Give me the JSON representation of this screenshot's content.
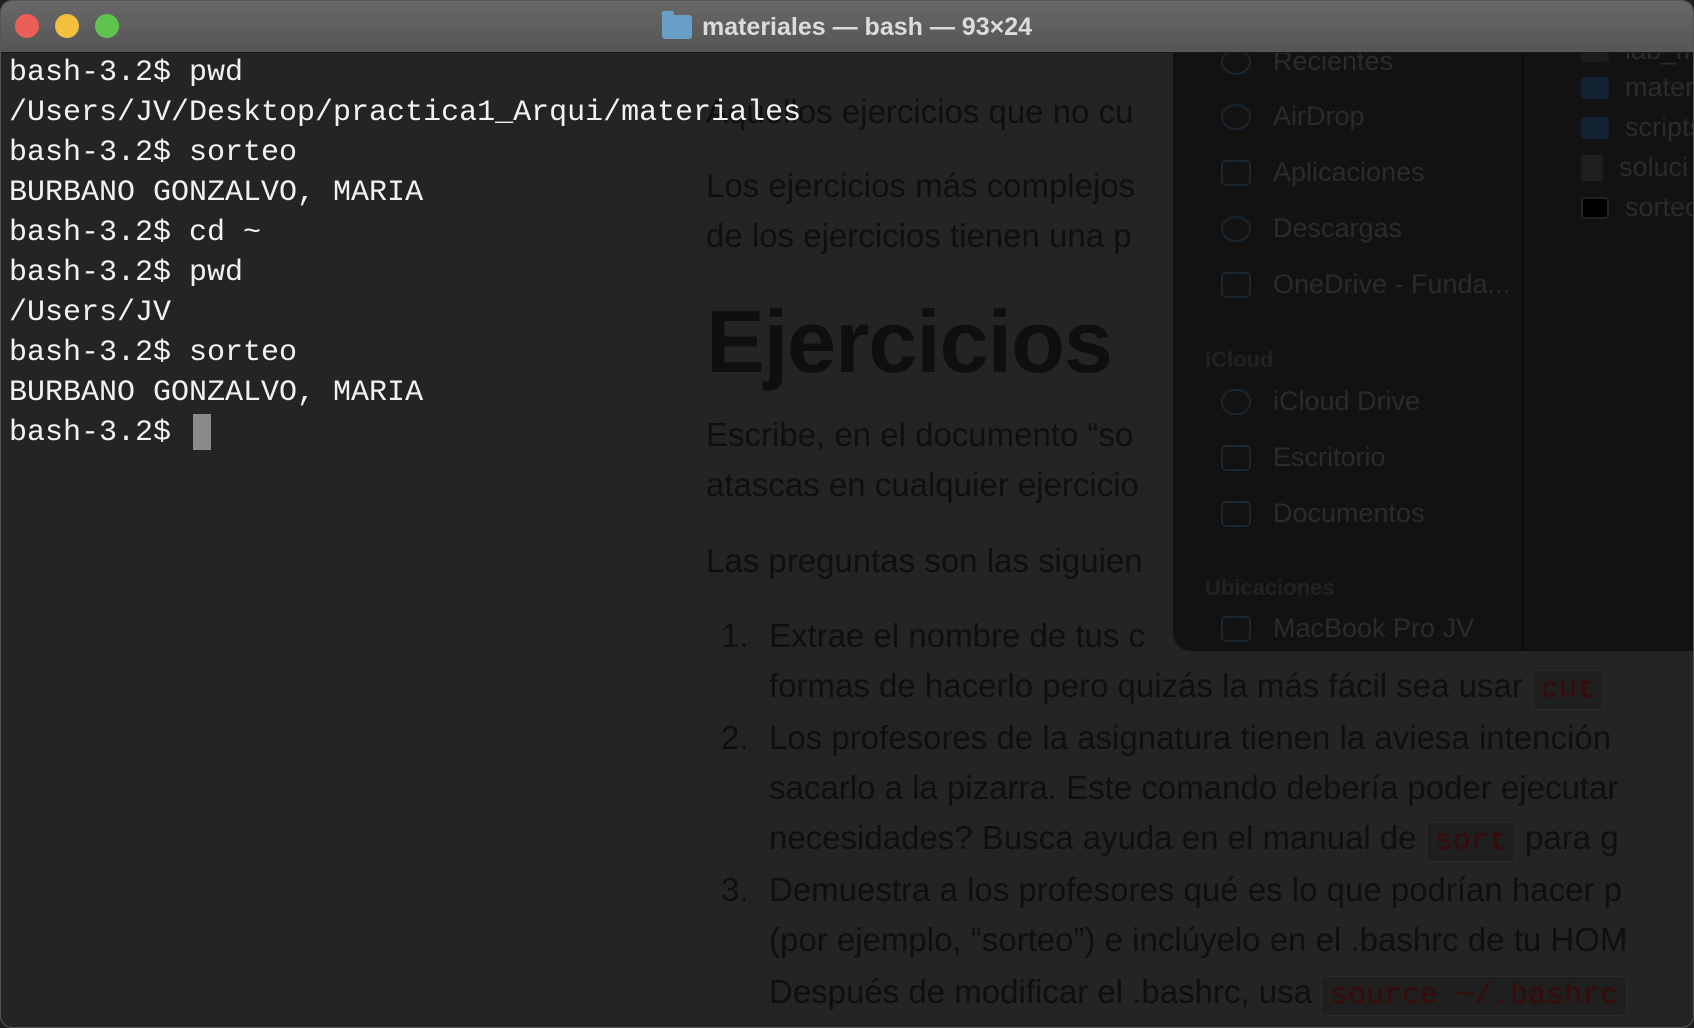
{
  "window": {
    "title": "materiales — bash — 93×24",
    "traffic": [
      "#ec5f58",
      "#f4be3f",
      "#5fc44d"
    ]
  },
  "terminal": {
    "lines": [
      "bash-3.2$ pwd",
      "/Users/JV/Desktop/practica1_Arqui/materiales",
      "bash-3.2$ sorteo",
      "BURBANO GONZALVO, MARIA",
      "bash-3.2$ cd ~",
      "bash-3.2$ pwd",
      "/Users/JV",
      "bash-3.2$ sorteo",
      "BURBANO GONZALVO, MARIA"
    ],
    "prompt": "bash-3.2$ "
  },
  "document": {
    "p1": "Aquellos ejercicios que no cu",
    "p2a": "Los ejercicios más complejos",
    "p2b": "de los ejercicios tienen una p",
    "heading": "Ejercicios",
    "p3a": "Escribe, en el documento “so",
    "p3b": "atascas en cualquier ejercicio",
    "p4": "Las preguntas son las siguien",
    "items": [
      {
        "num": "1.",
        "l1": "Extrae el nombre de tus c",
        "l2": "formas de hacerlo pero quizás la más fácil sea usar",
        "code2": "cut"
      },
      {
        "num": "2.",
        "l1": "Los profesores de la asignatura tienen la aviesa intención",
        "l2": "sacarlo a la pizarra. Este comando debería poder ejecutar",
        "l3": "necesidades? Busca ayuda en el manual de",
        "code3": "sort",
        "l3b": "para g"
      },
      {
        "num": "3.",
        "l1": "Demuestra a los profesores qué es lo que podrían hacer p",
        "l2": "(por ejemplo, “sorteo”) e inclúyelo en el .bashrc de tu HOM",
        "l3": "Después de modificar el .bashrc, usa",
        "code3": "source ~/.bashrc"
      }
    ]
  },
  "finder": {
    "favorites": [
      {
        "label": "Recientes",
        "icon": "clock-icon"
      },
      {
        "label": "AirDrop",
        "icon": "airdrop-icon"
      },
      {
        "label": "Aplicaciones",
        "icon": "apps-icon"
      },
      {
        "label": "Descargas",
        "icon": "download-icon"
      },
      {
        "label": "OneDrive - Funda...",
        "icon": "folder-icon"
      }
    ],
    "icloud_header": "iCloud",
    "icloud": [
      {
        "label": "iCloud Drive",
        "icon": "cloud-icon"
      },
      {
        "label": "Escritorio",
        "icon": "desktop-icon"
      },
      {
        "label": "Documentos",
        "icon": "document-icon"
      }
    ],
    "locations_header": "Ubicaciones",
    "locations": [
      {
        "label": "MacBook Pro JV",
        "icon": "laptop-icon"
      }
    ],
    "files": [
      "lab_m",
      "materi",
      "scripts",
      "soluci",
      "sorteo"
    ]
  }
}
